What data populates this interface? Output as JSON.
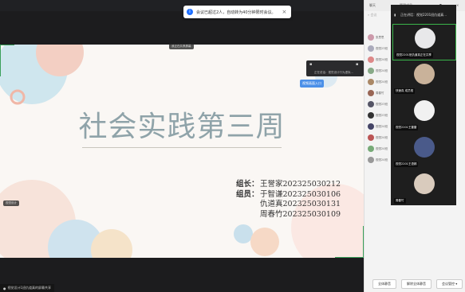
{
  "notice": {
    "text": "会议已超过2人，自动转为40分钟限时会议。",
    "close": "×"
  },
  "slide": {
    "title": "社会实践第三周",
    "leader_label": "组长：",
    "leader": "王誉家202325030212",
    "members_label": "组员：",
    "members": [
      "于智谦202325030106",
      "仇道真202325030131",
      "周春竹202325030109"
    ]
  },
  "stage": {
    "top_tag": "我正在共享屏幕",
    "blue_button": "视频画面入口",
    "ctrl_text": "正在说话：视觉设计行为虚拟...",
    "left_tag": "视觉设计",
    "bottom_label": "视觉设计1班仇道真的屏幕共享"
  },
  "panel": {
    "tab_chat": "聊天",
    "tab_members": "管理成员",
    "search": "会议",
    "members": [
      "张思思",
      "视觉23班",
      "视觉24班",
      "视觉24班",
      "视觉24班",
      "周春竹",
      "视觉23班",
      "视觉23班",
      "视觉24班",
      "视觉24班",
      "视觉24班",
      "视觉24班"
    ],
    "buttons": [
      "全体静音",
      "解除全体静音",
      "会议管控 ▾"
    ]
  },
  "videos": {
    "header": "正在讲话：视觉2201班仇道真...",
    "tiles": [
      {
        "name": "视觉2201班仇道真正在共享"
      },
      {
        "name": "快速真 成员视"
      },
      {
        "name": "视觉2201王雷雷"
      },
      {
        "name": "视觉2201王语嫣"
      },
      {
        "name": "周春竹"
      }
    ]
  }
}
